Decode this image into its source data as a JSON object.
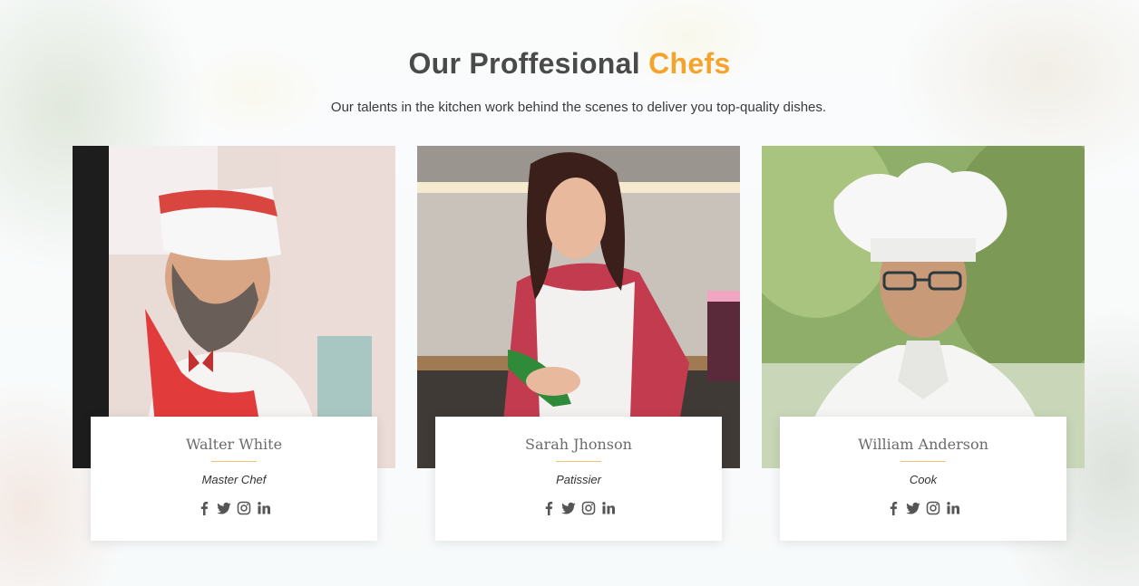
{
  "section": {
    "title_main": "Our Proffesional ",
    "title_accent": "Chefs",
    "subtitle": "Our talents in the kitchen work behind the scenes to deliver you top-quality dishes."
  },
  "colors": {
    "accent": "#f5a32c",
    "heading": "#4a4a4a",
    "divider": "#f0c27a"
  },
  "chefs": [
    {
      "name": "Walter White",
      "role": "Master Chef",
      "social": [
        "facebook-icon",
        "twitter-icon",
        "instagram-icon",
        "linkedin-icon"
      ]
    },
    {
      "name": "Sarah Jhonson",
      "role": "Patissier",
      "social": [
        "facebook-icon",
        "twitter-icon",
        "instagram-icon",
        "linkedin-icon"
      ]
    },
    {
      "name": "William Anderson",
      "role": "Cook",
      "social": [
        "facebook-icon",
        "twitter-icon",
        "instagram-icon",
        "linkedin-icon"
      ]
    }
  ]
}
